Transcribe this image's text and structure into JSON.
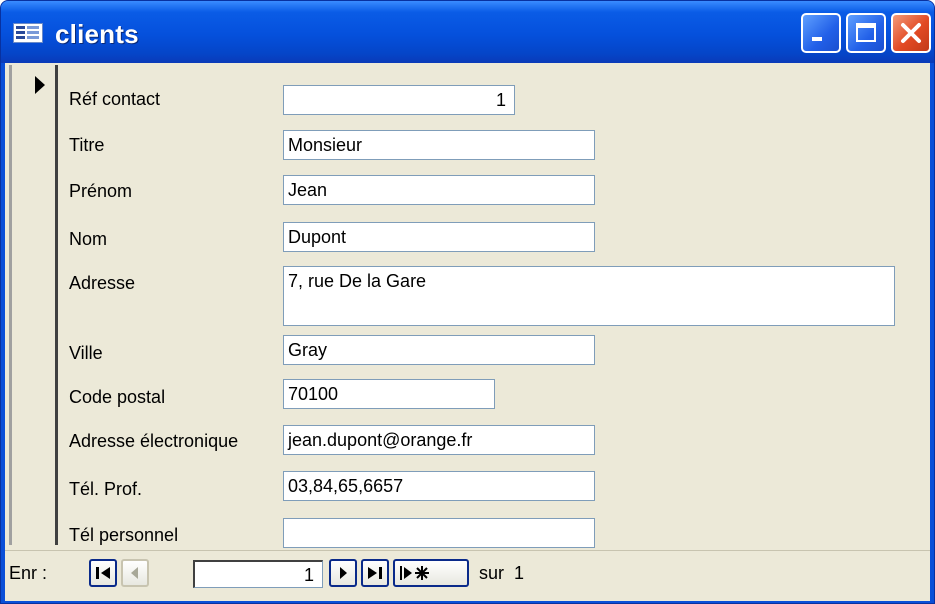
{
  "window": {
    "title": "clients"
  },
  "record_selector": {
    "icon": "current-record-arrow"
  },
  "fields": [
    {
      "name": "ref-contact",
      "label": "Réf contact",
      "value": "1"
    },
    {
      "name": "titre",
      "label": "Titre",
      "value": "Monsieur"
    },
    {
      "name": "prenom",
      "label": "Prénom",
      "value": "Jean"
    },
    {
      "name": "nom",
      "label": "Nom",
      "value": "Dupont"
    },
    {
      "name": "adresse",
      "label": "Adresse",
      "value": "7, rue De la Gare"
    },
    {
      "name": "ville",
      "label": "Ville",
      "value": "Gray"
    },
    {
      "name": "code-postal",
      "label": "Code postal",
      "value": "70100"
    },
    {
      "name": "adresse-electronique",
      "label": "Adresse électronique",
      "value": "jean.dupont@orange.fr"
    },
    {
      "name": "tel-prof",
      "label": "Tél. Prof.",
      "value": "03,84,65,6657"
    },
    {
      "name": "tel-personnel",
      "label": "Tél personnel",
      "value": ""
    }
  ],
  "navigation": {
    "label": "Enr :",
    "current_record": "1",
    "of_label": "sur",
    "total": "1"
  },
  "colors": {
    "titlebar": "#0550dc",
    "form_background": "#ece9d8",
    "input_border": "#7f9db9"
  }
}
